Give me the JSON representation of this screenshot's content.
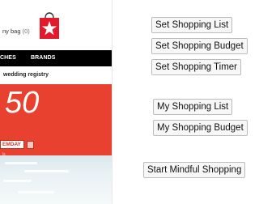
{
  "store_page": {
    "bag_label": "ny bag",
    "bag_count": "(0)",
    "nav_items": [
      "CHES",
      "BRANDS"
    ],
    "registry_link": "wedding registry",
    "promo_number": "50",
    "promo_code": "EMDAY",
    "promo_link": "ls",
    "colors": {
      "promo_red": "#e8412f",
      "nav_black": "#000000",
      "bag_red": "#e21a2c"
    }
  },
  "popup": {
    "buttons": [
      {
        "label": "Set Shopping List"
      },
      {
        "label": "Set Shopping Budget"
      },
      {
        "label": "Set Shopping Timer"
      },
      {
        "label": "My Shopping List"
      },
      {
        "label": "My Shopping Budget"
      },
      {
        "label": "Start Mindful Shopping"
      }
    ]
  }
}
